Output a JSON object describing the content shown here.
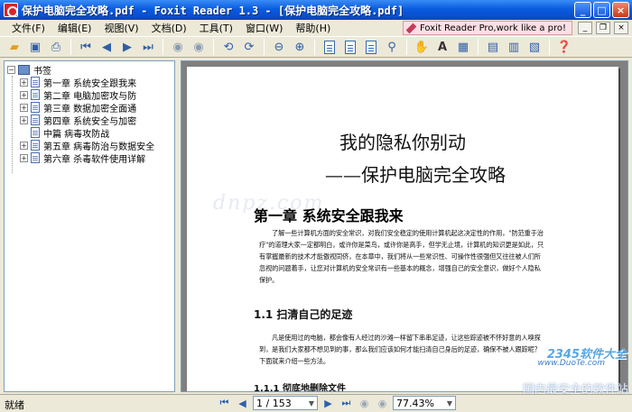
{
  "window": {
    "title": "保护电脑完全攻略.pdf - Foxit Reader 1.3 - [保护电脑完全攻略.pdf]",
    "buttons": {
      "minimize": "_",
      "maximize": "□",
      "close": "×"
    }
  },
  "menu": {
    "items": [
      "文件(F)",
      "编辑(E)",
      "视图(V)",
      "文档(D)",
      "工具(T)",
      "窗口(W)",
      "帮助(H)"
    ],
    "ad": "Foxit Reader Pro,work like a pro!"
  },
  "toolbar": {
    "icons": [
      "open-icon",
      "save-icon",
      "print-icon",
      "first-page-icon",
      "prev-page-icon",
      "next-page-icon",
      "last-page-icon",
      "back-icon",
      "forward-icon",
      "rotate-left-icon",
      "rotate-right-icon",
      "zoom-out-icon",
      "zoom-in-icon",
      "actual-size-icon",
      "fit-page-icon",
      "fit-width-icon",
      "find-icon",
      "hand-tool-icon",
      "text-select-icon",
      "snapshot-icon",
      "single-page-icon",
      "continuous-icon",
      "facing-icon",
      "help-icon"
    ]
  },
  "bookmarks": {
    "root": "书签",
    "items": [
      "第一章 系统安全跟我来",
      "第二章 电脑加密攻与防",
      "第三章 数据加密全面通",
      "第四章 系统安全与加密",
      "中篇 病毒攻防战",
      "第五章 病毒防治与数据安全",
      "第六章 杀毒软件使用详解"
    ]
  },
  "page": {
    "title": "我的隐私你别动",
    "subtitle": "——保护电脑完全攻略",
    "chapter": "第一章 系统安全跟我来",
    "para1": "了解一些计算机方面的安全常识，对我们安全稳定的使用计算机起这决定性的作用，\"防范重于治疗\"的道理大家一定都明白，或许你是菜鸟，或许你是高手，但学无止境，计算机的知识更是如此，只有掌握最新的技术才能傲视同侪，在本章中，我们将从一些常识性、可操作性很强但又往往被人们所忽视的问题着手，让您对计算机的安全常识有一些基本的概念，增强自己的安全意识，做好个人隐私保护。",
    "section1": "1.1 扫清自己的足迹",
    "para2": "凡是使用过的电脑，都会像有人经过的沙滩一样留下串串足迹，让这些踪迹被不怀好意的人嗅探到，是我们大家都不想见到的事，那么我们应该如何才能扫清自己身后的足迹，确保不被人跟踪呢？下面就来介绍一些方法。",
    "section2": "1.1.1 彻底地删除文件",
    "watermark": "dnpz.com"
  },
  "watermark_logo": {
    "brand": "2345软件大全",
    "url": "www.DuoTe.com",
    "slogan": "国内最安全的软件站"
  },
  "status": {
    "text": "就绪",
    "page_indicator": "1 / 153",
    "zoom": "77.43%"
  }
}
